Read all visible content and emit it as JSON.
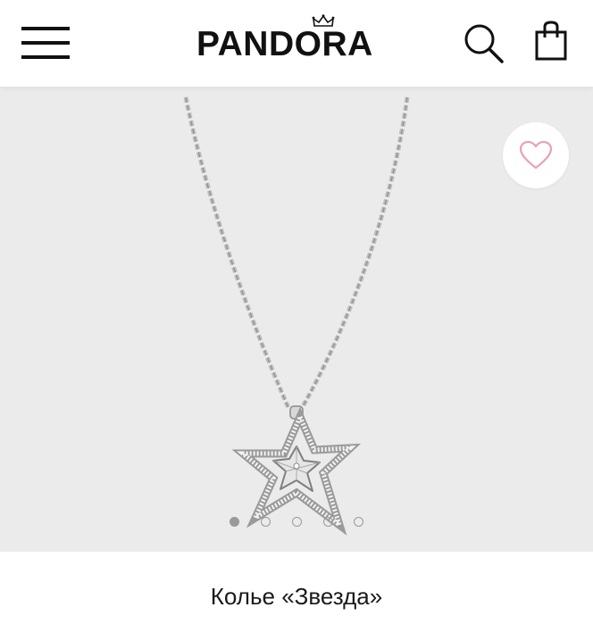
{
  "header": {
    "brand": "PANDORA",
    "menu_icon": "hamburger-menu-icon",
    "search_icon": "search-icon",
    "bag_icon": "shopping-bag-icon"
  },
  "gallery": {
    "favorite_icon": "heart-icon",
    "accent_color": "#e8a2b4",
    "background_color": "#ebebeb",
    "slide_count": 5,
    "active_slide": 1
  },
  "product": {
    "title": "Колье «Звезда»"
  }
}
